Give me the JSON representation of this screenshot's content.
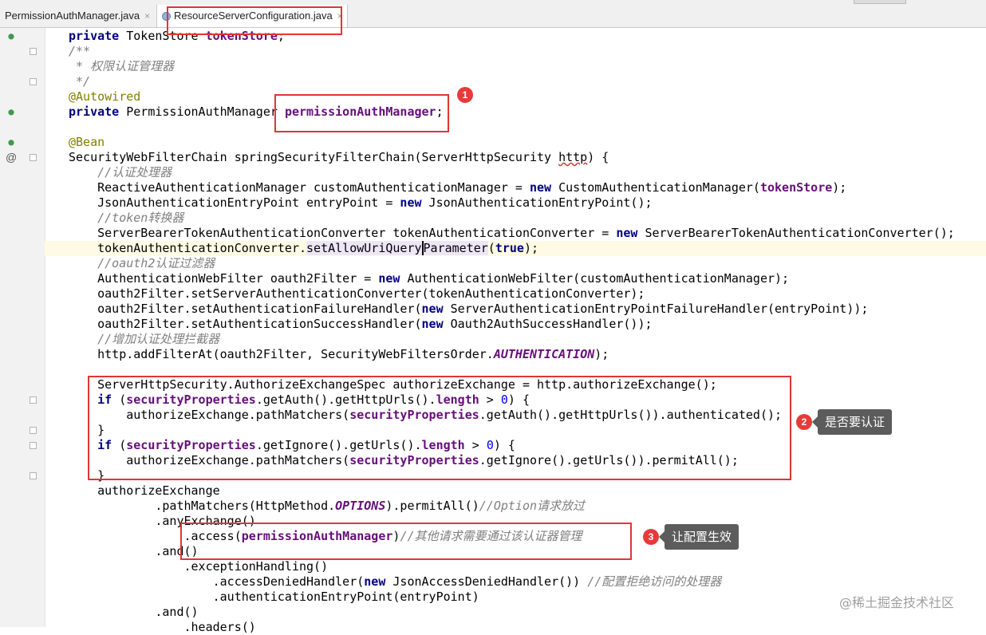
{
  "tabs": [
    {
      "label": "PermissionAuthManager.java",
      "close": "×"
    },
    {
      "label": "ResourceServerConfiguration.java",
      "close": "×"
    }
  ],
  "gutter": {
    "at_marker": "@"
  },
  "code_lines": [
    [
      {
        "t": "private",
        "c": "kw"
      },
      {
        "t": " TokenStore "
      },
      {
        "t": "tokenStore",
        "c": "field"
      },
      {
        "t": ";"
      }
    ],
    [
      {
        "t": "/**",
        "c": "cm"
      }
    ],
    [
      {
        "t": " * 权限认证管理器",
        "c": "cm"
      }
    ],
    [
      {
        "t": " */",
        "c": "cm"
      }
    ],
    [
      {
        "t": "@Autowired",
        "c": "an"
      }
    ],
    [
      {
        "t": "private",
        "c": "kw"
      },
      {
        "t": " PermissionAuthManager "
      },
      {
        "t": "permissionAuthManager",
        "c": "field"
      },
      {
        "t": ";"
      }
    ],
    [],
    [
      {
        "t": "@Bean",
        "c": "an"
      }
    ],
    [
      {
        "t": "SecurityWebFilterChain springSecurityFilterChain(ServerHttpSecurity "
      },
      {
        "t": "http",
        "c": "ident"
      },
      {
        "t": ") {"
      }
    ],
    [
      {
        "t": "    //认证处理器",
        "c": "cm"
      }
    ],
    [
      {
        "t": "    ReactiveAuthenticationManager customAuthenticationManager = "
      },
      {
        "t": "new",
        "c": "kw"
      },
      {
        "t": " CustomAuthenticationManager("
      },
      {
        "t": "tokenStore",
        "c": "field"
      },
      {
        "t": ");"
      }
    ],
    [
      {
        "t": "    JsonAuthenticationEntryPoint entryPoint = "
      },
      {
        "t": "new",
        "c": "kw"
      },
      {
        "t": " JsonAuthenticationEntryPoint();"
      }
    ],
    [
      {
        "t": "    //token转换器",
        "c": "cm"
      }
    ],
    [
      {
        "t": "    ServerBearerTokenAuthenticationConverter tokenAuthenticationConverter = "
      },
      {
        "t": "new",
        "c": "kw"
      },
      {
        "t": " ServerBearerTokenAuthenticationConverter();"
      }
    ],
    [
      {
        "t": "    tokenAuthenticationConverter."
      },
      {
        "t": "setAllowUriQuery",
        "c": "ref"
      },
      {
        "t": "Parameter",
        "c": "ref cursor"
      },
      {
        "t": "("
      },
      {
        "t": "true",
        "c": "kw"
      },
      {
        "t": ");"
      }
    ],
    [
      {
        "t": "    //oauth2认证过滤器",
        "c": "cm"
      }
    ],
    [
      {
        "t": "    AuthenticationWebFilter oauth2Filter = "
      },
      {
        "t": "new",
        "c": "kw"
      },
      {
        "t": " AuthenticationWebFilter(customAuthenticationManager);"
      }
    ],
    [
      {
        "t": "    oauth2Filter.setServerAuthenticationConverter(tokenAuthenticationConverter);"
      }
    ],
    [
      {
        "t": "    oauth2Filter.setAuthenticationFailureHandler("
      },
      {
        "t": "new",
        "c": "kw"
      },
      {
        "t": " ServerAuthenticationEntryPointFailureHandler(entryPoint));"
      }
    ],
    [
      {
        "t": "    oauth2Filter.setAuthenticationSuccessHandler("
      },
      {
        "t": "new",
        "c": "kw"
      },
      {
        "t": " Oauth2AuthSuccessHandler());"
      }
    ],
    [
      {
        "t": "    //增加认证处理拦截器",
        "c": "cm"
      }
    ],
    [
      {
        "t": "    http.addFilterAt(oauth2Filter, SecurityWebFiltersOrder."
      },
      {
        "t": "AUTHENTICATION",
        "c": "sfield"
      },
      {
        "t": ");"
      }
    ],
    [],
    [
      {
        "t": "    ServerHttpSecurity.AuthorizeExchangeSpec authorizeExchange = http.authorizeExchange();"
      }
    ],
    [
      {
        "t": "    "
      },
      {
        "t": "if",
        "c": "kw"
      },
      {
        "t": " ("
      },
      {
        "t": "securityProperties",
        "c": "field"
      },
      {
        "t": ".getAuth().getHttpUrls()."
      },
      {
        "t": "length",
        "c": "field"
      },
      {
        "t": " > "
      },
      {
        "t": "0",
        "c": "num"
      },
      {
        "t": ") {"
      }
    ],
    [
      {
        "t": "        authorizeExchange.pathMatchers("
      },
      {
        "t": "securityProperties",
        "c": "field"
      },
      {
        "t": ".getAuth().getHttpUrls()).authenticated();"
      }
    ],
    [
      {
        "t": "    }"
      }
    ],
    [
      {
        "t": "    "
      },
      {
        "t": "if",
        "c": "kw"
      },
      {
        "t": " ("
      },
      {
        "t": "securityProperties",
        "c": "field"
      },
      {
        "t": ".getIgnore().getUrls()."
      },
      {
        "t": "length",
        "c": "field"
      },
      {
        "t": " > "
      },
      {
        "t": "0",
        "c": "num"
      },
      {
        "t": ") {"
      }
    ],
    [
      {
        "t": "        authorizeExchange.pathMatchers("
      },
      {
        "t": "securityProperties",
        "c": "field"
      },
      {
        "t": ".getIgnore().getUrls()).permitAll();"
      }
    ],
    [
      {
        "t": "    }"
      }
    ],
    [
      {
        "t": "    authorizeExchange"
      }
    ],
    [
      {
        "t": "            .pathMatchers(HttpMethod."
      },
      {
        "t": "OPTIONS",
        "c": "sfield"
      },
      {
        "t": ").permitAll()"
      },
      {
        "t": "//Option请求放过",
        "c": "cm"
      }
    ],
    [
      {
        "t": "            .anyExchange()"
      }
    ],
    [
      {
        "t": "                .access("
      },
      {
        "t": "permissionAuthManager",
        "c": "field"
      },
      {
        "t": ")"
      },
      {
        "t": "//其他请求需要通过该认证器管理",
        "c": "cm"
      }
    ],
    [
      {
        "t": "            .and()"
      }
    ],
    [
      {
        "t": "                .exceptionHandling()"
      }
    ],
    [
      {
        "t": "                    .accessDeniedHandler("
      },
      {
        "t": "new",
        "c": "kw"
      },
      {
        "t": " JsonAccessDeniedHandler()) "
      },
      {
        "t": "//配置拒绝访问的处理器",
        "c": "cm"
      }
    ],
    [
      {
        "t": "                    .authenticationEntryPoint(entryPoint)"
      }
    ],
    [
      {
        "t": "            .and()"
      }
    ],
    [
      {
        "t": "                .headers()"
      }
    ]
  ],
  "annotations": [
    {
      "number": "1"
    },
    {
      "number": "2",
      "label": "是否要认证"
    },
    {
      "number": "3",
      "label": "让配置生效"
    }
  ],
  "watermark": "@稀土掘金技术社区",
  "colors": {
    "keyword": "#000080",
    "field": "#660e7a",
    "comment": "#808080",
    "annotation": "#808000",
    "number": "#0000ff",
    "highlight_box": "#e03535",
    "callout_bg": "#5c5c5c"
  }
}
